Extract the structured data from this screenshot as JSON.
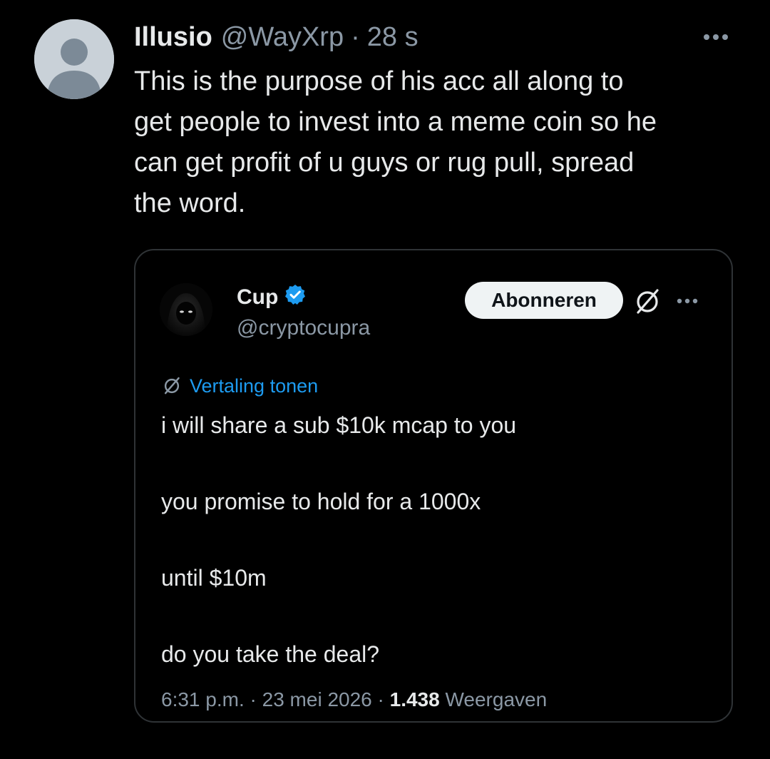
{
  "tweet": {
    "display_name": "Illusio",
    "handle": "@WayXrp",
    "separator": "·",
    "time": "28 s",
    "text": "This is the purpose of his acc all along to\nget people to invest into a meme coin so he\ncan get profit of u guys or rug pull, spread\nthe word.",
    "more_icon": "more-horizontal-icon",
    "avatar_icon": "default-avatar-icon"
  },
  "quote": {
    "display_name": "Cup",
    "handle": "@cryptocupra",
    "verified_icon": "verified-badge-icon",
    "subscribe_label": "Abonneren",
    "grok_icon": "grok-icon",
    "more_icon": "more-horizontal-icon",
    "translate_label": "Vertaling tonen",
    "lines": [
      "i will share a sub $10k mcap to you",
      "you promise to hold for a 1000x",
      "until $10m",
      "do you take the deal?"
    ],
    "time": "6:31 p.m.",
    "separator": "·",
    "date": "23 mei 2026",
    "views_count": "1.438",
    "views_label": "Weergaven"
  },
  "colors": {
    "background": "#000000",
    "text_primary": "#e7e9ea",
    "text_secondary": "#8b98a5",
    "accent_blue": "#1d9bf0",
    "border": "#2f3336",
    "button_bg": "#eff3f4"
  }
}
